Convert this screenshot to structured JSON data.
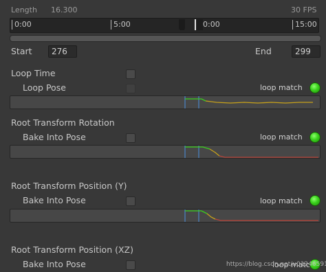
{
  "header": {
    "length_label": "Length",
    "length_value": "16.300",
    "fps_label": "30 FPS"
  },
  "timeline": {
    "ticks": [
      "0:00",
      "5:00",
      "10:00",
      "15:00"
    ],
    "handle_left_label": "",
    "handle_right_label": ""
  },
  "range": {
    "start_label": "Start",
    "start_value": "276",
    "end_label": "End",
    "end_value": "299"
  },
  "sections": {
    "loop_time": {
      "label": "Loop Time",
      "sub_label": "Loop Pose",
      "match_label": "loop match"
    },
    "rotation": {
      "label": "Root Transform Rotation",
      "sub_label": "Bake Into Pose",
      "match_label": "loop match"
    },
    "position_y": {
      "label": "Root Transform Position (Y)",
      "sub_label": "Bake Into Pose",
      "match_label": "loop match"
    },
    "position_xz": {
      "label": "Root Transform Position (XZ)",
      "sub_label": "Bake Into Pose",
      "match_label": "loop match"
    }
  },
  "colors": {
    "match_green": "#3ad21c",
    "curve_yellow": "#c8a21a",
    "curve_red": "#b8443a",
    "marker_blue": "#4a86c8"
  },
  "watermark": "https://blog.csdn.net/u012465919"
}
